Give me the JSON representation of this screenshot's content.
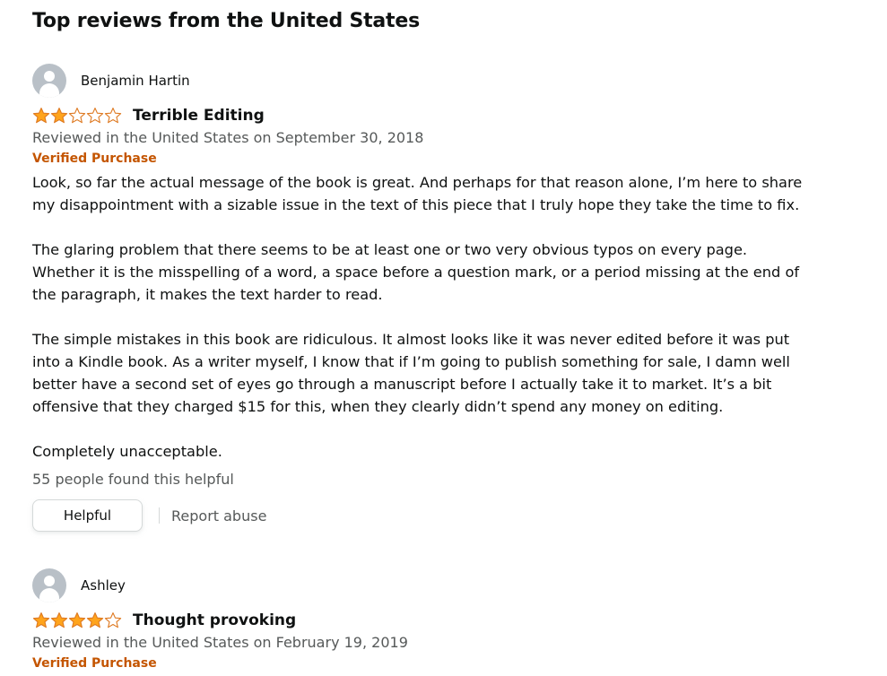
{
  "section": {
    "title": "Top reviews from the United States"
  },
  "colors": {
    "star": "#ffa41c",
    "star_outline": "#de7921",
    "verified": "#c45500",
    "secondary_text": "#565959"
  },
  "reviews": [
    {
      "author": "Benjamin Hartin",
      "rating": 2,
      "max_rating": 5,
      "title": "Terrible Editing",
      "date": "Reviewed in the United States on September 30, 2018",
      "verified": "Verified Purchase",
      "body": [
        "Look, so far the actual message of the book is great. And perhaps for that reason alone, I’m here to share my disappointment with a sizable issue in the text of this piece that I truly hope they take the time to fix.",
        "The glaring problem that there seems to be at least one or two very obvious typos on every page. Whether it is the misspelling of a word, a space before a question mark, or a period missing at the end of the paragraph, it makes the text harder to read.",
        "The simple mistakes in this book are ridiculous. It almost looks like it was never edited before it was put into a Kindle book. As a writer myself, I know that if I’m going to publish something for sale, I damn well better have a second set of eyes go through a manuscript before I actually take it to market. It’s a bit offensive that they charged $15 for this, when they clearly didn’t spend any money on editing.",
        "Completely unacceptable."
      ],
      "helpful_count": "55 people found this helpful",
      "helpful_button": "Helpful",
      "report_link": "Report abuse"
    },
    {
      "author": "Ashley",
      "rating": 4,
      "max_rating": 5,
      "title": "Thought provoking",
      "date": "Reviewed in the United States on February 19, 2019",
      "verified": "Verified Purchase"
    }
  ]
}
